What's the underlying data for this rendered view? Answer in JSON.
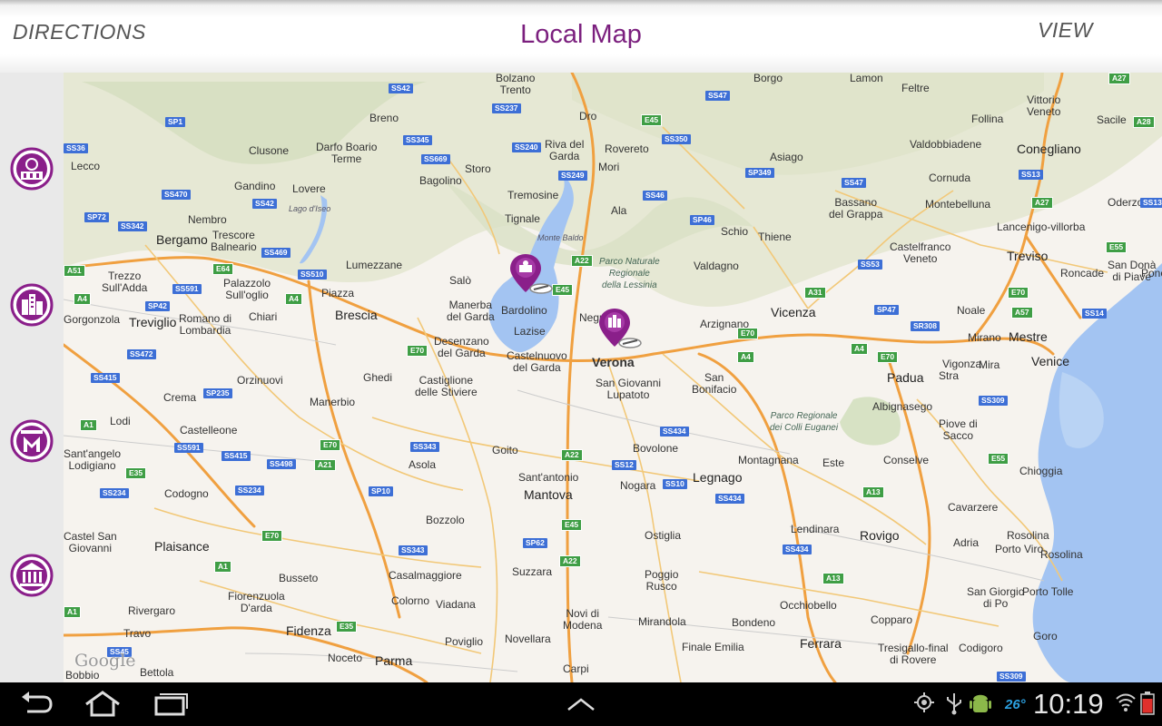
{
  "header": {
    "directions_label": "DIRECTIONS",
    "title": "Local Map",
    "view_label": "VIEW"
  },
  "sidebar": {
    "items": [
      {
        "icon": "attractions-icon"
      },
      {
        "icon": "city-buildings-icon"
      },
      {
        "icon": "museum-m-icon"
      },
      {
        "icon": "monument-icon"
      }
    ]
  },
  "map": {
    "attribution": "Google",
    "cities": [
      {
        "name": "Trento"
      },
      {
        "name": "Bolzano"
      },
      {
        "name": "Verona"
      },
      {
        "name": "Vicenza"
      },
      {
        "name": "Padua"
      },
      {
        "name": "Venice"
      },
      {
        "name": "Treviso"
      },
      {
        "name": "Brescia"
      },
      {
        "name": "Bergamo"
      },
      {
        "name": "Mantova"
      },
      {
        "name": "Parma"
      },
      {
        "name": "Ferrara"
      },
      {
        "name": "Rovigo"
      },
      {
        "name": "Mestre"
      }
    ],
    "labels": [
      "Bolzano\nTrento",
      "Breno",
      "Clusone",
      "Darfo Boario\nTerme",
      "Riva del\nGarda",
      "Rovereto",
      "Mori",
      "Storo",
      "Bagolino",
      "Tremosine",
      "Lecco",
      "Gandino",
      "Lovere",
      "Lago d'Iseo",
      "Nembro",
      "Bergamo",
      "Trescore\nBalneario",
      "Lumezzane",
      "Tignale",
      "Monte Baldo",
      "Ala",
      "Schio",
      "Thiene",
      "Valdagno",
      "Arzignano",
      "Vicenza",
      "Bassano\ndel Grappa",
      "Montebelluna",
      "Castelfranco\nVeneto",
      "Treviso",
      "Ponc",
      "Roncade",
      "San Donà\ndi Piave",
      "Trezzo\nSull'Adda",
      "Palazzolo\nSull'oglio",
      "Piazza",
      "Brescia",
      "Salò",
      "Manerba\ndel Garda",
      "Bardolino",
      "Lazise",
      "Negrar",
      "Verona",
      "Gorgonzola",
      "Treviglio",
      "Romano di\nLombardia",
      "Chiari",
      "Desenzano\ndel Garda",
      "Castelnuovo\ndel Garda",
      "San Giovanni\nLupatoto",
      "San\nBonifacio",
      "Padua",
      "Stra",
      "Mira",
      "Mestre",
      "Venice",
      "Orzinuovi",
      "Ghedi",
      "Castiglione\ndelle Stiviere",
      "Crema",
      "Manerbio",
      "Lodi",
      "Castelleone",
      "Goito",
      "Asola",
      "Bovolone",
      "Montagnana",
      "Este",
      "Conselve",
      "Piove di\nSacco",
      "Chioggia",
      "Albignasego",
      "Sant'angelo\nLodigiano",
      "Codogno",
      "Sant'antonio",
      "Mantova",
      "Nogara",
      "Legnago",
      "Cavarzere",
      "Bozzolo",
      "Ostiglia",
      "Lendinara",
      "Rovigo",
      "Adria",
      "Rosolina",
      "Porto Viro",
      "San Giorgio\ndi Po",
      "Castel San\nGiovanni",
      "Plaisance",
      "Busseto",
      "Casalmaggiore",
      "Suzzara",
      "Poggio\nRusco",
      "Fiorenzuola\nD'arda",
      "Colorno",
      "Viadana",
      "Occhiobello",
      "Porto Tolle",
      "Rivergaro",
      "Fidenza",
      "Novi di\nModena",
      "Mirandola",
      "Bondeno",
      "Copparo",
      "Travo",
      "Noceto",
      "Parma",
      "Poviglio",
      "Novellara",
      "Finale Emilia",
      "Ferrara",
      "Tresigallo-final\ndi Rovere",
      "Codigoro",
      "Goro",
      "Bobbio",
      "Bettola",
      "Carpi",
      "Feltre",
      "Follina",
      "Vittorio\nVeneto",
      "Sacile",
      "Valdobbiadene",
      "Conegliano",
      "Cornuda",
      "Oderzo",
      "Lancenigo-villorba",
      "Asiago",
      "Borgo",
      "Lamon",
      "Dro",
      "Noale",
      "Mirano",
      "Vigonza",
      "Rosolina",
      "Parco Naturale\nRegionale\ndella Lessinia",
      "Parco Regionale\ndei Colli Euganei"
    ],
    "markers": [
      {
        "name": "Lake Garda attraction",
        "category": "attractions"
      },
      {
        "name": "Verona attraction",
        "category": "city"
      }
    ]
  },
  "navbar": {
    "back_icon": "back-arrow-icon",
    "home_icon": "home-icon",
    "recents_icon": "recent-apps-icon",
    "up_icon": "chevron-up-icon"
  },
  "status": {
    "temperature": "26°",
    "time": "10:19"
  },
  "colors": {
    "brand": "#7b1f7e",
    "accent_blue": "#2ca0e0"
  }
}
